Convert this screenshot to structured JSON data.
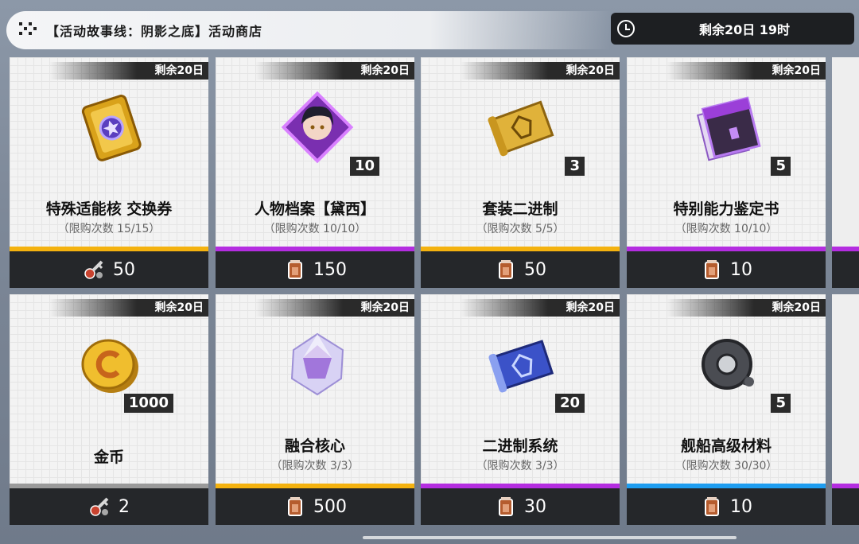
{
  "header": {
    "shop_title": "【活动故事线：阴影之底】活动商店",
    "timer_text": "剩余20日  19时"
  },
  "colors": {
    "gold": "#f4b20f",
    "purple": "#b42de0",
    "blue": "#1e9df0",
    "gray": "#9a9a9a"
  },
  "cards": [
    {
      "badge": "剩余20日",
      "name": "特殊适能核 交换券",
      "limit": "（限购次数 15/15）",
      "qty": "",
      "price": "50",
      "currency": "key-icon",
      "bar": "gold",
      "icon": "golden-card-icon"
    },
    {
      "badge": "剩余20日",
      "name": "人物档案【黛西】",
      "limit": "（限购次数 10/10）",
      "qty": "10",
      "price": "150",
      "currency": "canister-icon",
      "bar": "purple",
      "icon": "character-portrait-icon"
    },
    {
      "badge": "剩余20日",
      "name": "套装二进制",
      "limit": "（限购次数 5/5）",
      "qty": "3",
      "price": "50",
      "currency": "canister-icon",
      "bar": "gold",
      "icon": "gold-scroll-icon"
    },
    {
      "badge": "剩余20日",
      "name": "特别能力鉴定书",
      "limit": "（限购次数 10/10）",
      "qty": "5",
      "price": "10",
      "currency": "canister-icon",
      "bar": "purple",
      "icon": "folder-documents-icon"
    },
    {
      "badge": "剩余20日",
      "name": "金币",
      "limit": "",
      "qty": "1000",
      "price": "2",
      "currency": "key-icon",
      "bar": "gray",
      "icon": "gold-coin-icon"
    },
    {
      "badge": "剩余20日",
      "name": "融合核心",
      "limit": "（限购次数 3/3）",
      "qty": "",
      "price": "500",
      "currency": "canister-icon",
      "bar": "gold",
      "icon": "crystal-core-icon"
    },
    {
      "badge": "剩余20日",
      "name": "二进制系统",
      "limit": "（限购次数 3/3）",
      "qty": "20",
      "price": "30",
      "currency": "canister-icon",
      "bar": "purple",
      "icon": "blue-scroll-icon"
    },
    {
      "badge": "剩余20日",
      "name": "舰船高级材料",
      "limit": "（限购次数 30/30）",
      "qty": "5",
      "price": "10",
      "currency": "canister-icon",
      "bar": "blue",
      "icon": "gear-part-icon"
    }
  ]
}
